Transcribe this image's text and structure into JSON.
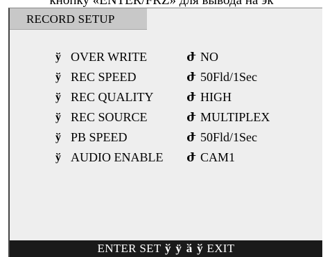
{
  "caption": "кнопку «ENTER/FRZ» для вывода на эк",
  "title": "RECORD SETUP",
  "items": [
    {
      "label": "OVER WRITE",
      "value": "NO"
    },
    {
      "label": "REC SPEED",
      "value": "50Fld/1Sec"
    },
    {
      "label": "REC QUALITY",
      "value": "HIGH"
    },
    {
      "label": "REC SOURCE",
      "value": "MULTIPLEX"
    },
    {
      "label": "PB SPEED",
      "value": "50Fld/1Sec"
    },
    {
      "label": "AUDIO ENABLE",
      "value": "CAM1"
    }
  ],
  "bullet_glyph": "ў",
  "arrow_glyph": "ժ",
  "footer": {
    "enter": "ENTER",
    "set": "SET",
    "nav": [
      "ў",
      "ӱ",
      "ӑ",
      "ў"
    ],
    "exit": "EXIT"
  }
}
